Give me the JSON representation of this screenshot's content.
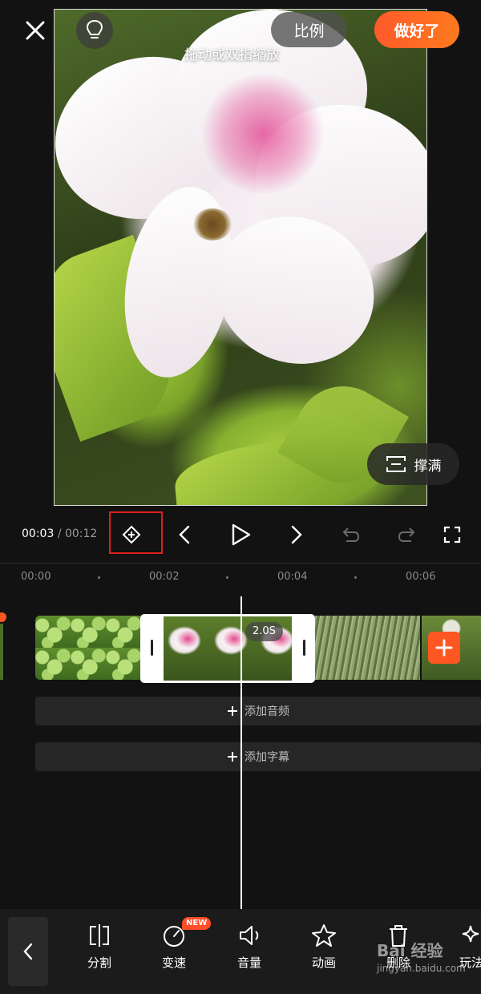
{
  "header": {
    "ratio_label": "比例",
    "done_label": "做好了"
  },
  "preview": {
    "hint": "拖动或双指缩放",
    "fill_label": "撑满"
  },
  "controls": {
    "current_time": "00:03",
    "separator": "/",
    "total_time": "00:12"
  },
  "ruler": {
    "ticks": [
      "00:00",
      "00:02",
      "00:04",
      "00:06"
    ]
  },
  "timeline": {
    "selected_clip_duration": "2.0S",
    "add_audio": "添加音频",
    "add_subtitle": "添加字幕"
  },
  "toolbar": {
    "items": [
      {
        "label": "分割",
        "icon": "split-icon"
      },
      {
        "label": "变速",
        "icon": "speed-icon",
        "badge": "NEW"
      },
      {
        "label": "音量",
        "icon": "volume-icon"
      },
      {
        "label": "动画",
        "icon": "star-icon"
      },
      {
        "label": "删除",
        "icon": "trash-icon"
      },
      {
        "label": "玩法",
        "icon": "sparkle-icon"
      }
    ]
  },
  "watermark": {
    "brand": "Bai 经验",
    "domain": "jingyan.baidu.com"
  },
  "colors": {
    "accent": "#ff5722",
    "annotation_box": "#e01e1e",
    "background": "#121212"
  }
}
